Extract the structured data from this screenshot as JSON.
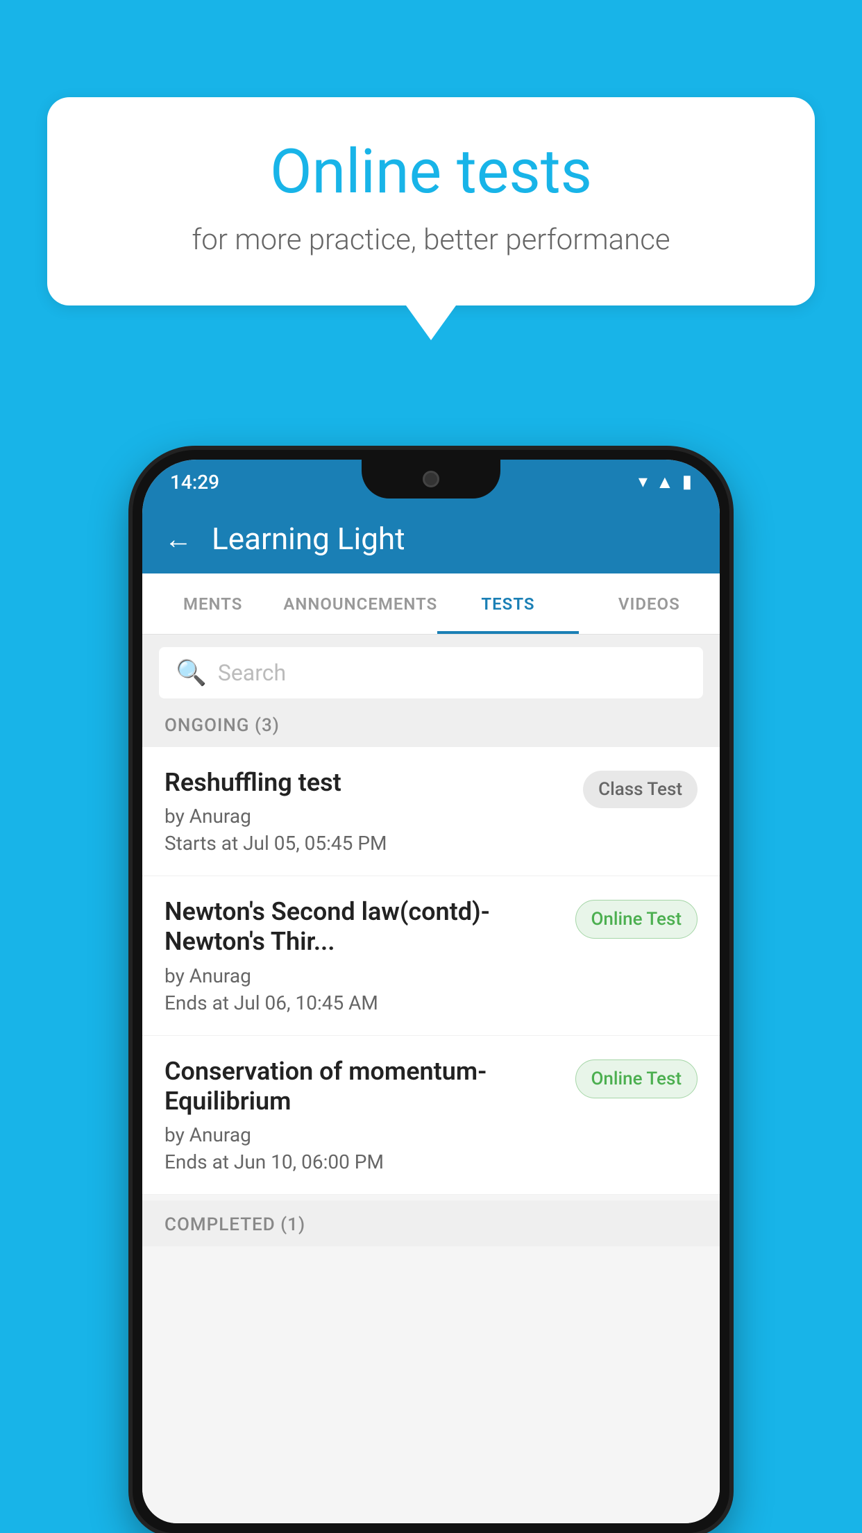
{
  "background": {
    "color": "#18b4e8"
  },
  "speech_bubble": {
    "title": "Online tests",
    "subtitle": "for more practice, better performance"
  },
  "phone": {
    "status_bar": {
      "time": "14:29",
      "icons": [
        "wifi",
        "signal",
        "battery"
      ]
    },
    "header": {
      "title": "Learning Light",
      "back_label": "←"
    },
    "tabs": [
      {
        "label": "MENTS",
        "active": false
      },
      {
        "label": "ANNOUNCEMENTS",
        "active": false
      },
      {
        "label": "TESTS",
        "active": true
      },
      {
        "label": "VIDEOS",
        "active": false
      }
    ],
    "search": {
      "placeholder": "Search"
    },
    "ongoing_section": {
      "label": "ONGOING (3)"
    },
    "test_items": [
      {
        "title": "Reshuffling test",
        "by": "by Anurag",
        "date": "Starts at  Jul 05, 05:45 PM",
        "badge": "Class Test",
        "badge_type": "class"
      },
      {
        "title": "Newton's Second law(contd)-Newton's Thir...",
        "by": "by Anurag",
        "date": "Ends at  Jul 06, 10:45 AM",
        "badge": "Online Test",
        "badge_type": "online"
      },
      {
        "title": "Conservation of momentum-Equilibrium",
        "by": "by Anurag",
        "date": "Ends at  Jun 10, 06:00 PM",
        "badge": "Online Test",
        "badge_type": "online"
      }
    ],
    "completed_section": {
      "label": "COMPLETED (1)"
    }
  }
}
